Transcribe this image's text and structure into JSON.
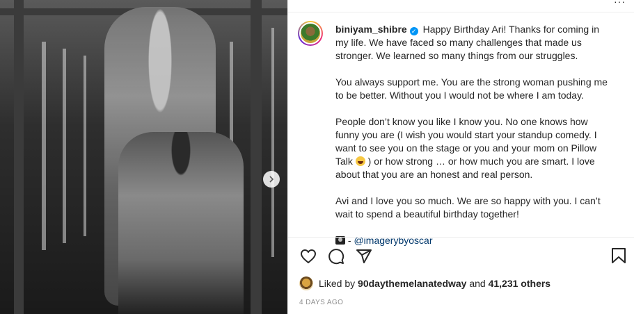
{
  "post": {
    "username": "biniyam_shibre",
    "verified_mark": "✓",
    "caption": {
      "para1": "Happy Birthday Ari! Thanks for coming in my life. We have faced so many challenges that made us stronger. We learned so many things from our struggles.",
      "para2": "You always support me. You are the strong woman pushing me to be better. Without you I would not be where I am today.",
      "para3_before_emoji": "People don’t know you like I know you. No one knows how funny you are (I wish you would start your standup comedy. I want to see you on the stage or you and your mom on Pillow Talk ",
      "para3_after_emoji": " ) or how strong … or how much you are smart. I love about that you are an honest and real person.",
      "para4": "Avi and I love you so much. We are so happy with you. I can’t wait to spend a beautiful birthday together!",
      "credit_separator": " - ",
      "credit_handle": "@imagerybyoscar"
    },
    "likes": {
      "prefix": "Liked by ",
      "liker": "90daythemelanatedway",
      "and": " and ",
      "count_text": "41,231 others"
    },
    "timestamp": "4 DAYS AGO",
    "more_menu": "···"
  },
  "icons": {
    "like": "heart-icon",
    "comment": "comment-icon",
    "share": "send-icon",
    "save": "bookmark-icon",
    "next": "chevron-right-icon",
    "verified": "verified-badge-icon"
  },
  "colors": {
    "link": "#00376b",
    "verified": "#0095f6",
    "muted": "#8e8e8e",
    "text": "#262626"
  }
}
